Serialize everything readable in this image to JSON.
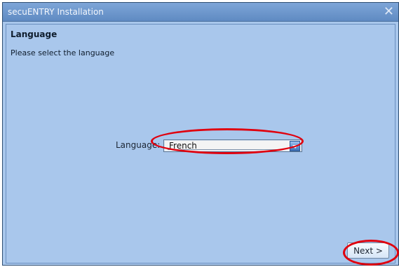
{
  "window": {
    "title": "secuENTRY Installation",
    "close_label": "✕"
  },
  "header": {
    "title": "Language",
    "subtitle": "Please select the language"
  },
  "form": {
    "language_label": "Language:",
    "language_value": "French"
  },
  "footer": {
    "next_label": "Next >"
  },
  "colors": {
    "window_bg": "#a9c7ec",
    "titlebar_start": "#7ea6d8",
    "titlebar_end": "#5f8ac2",
    "annotation": "#e0000e"
  }
}
